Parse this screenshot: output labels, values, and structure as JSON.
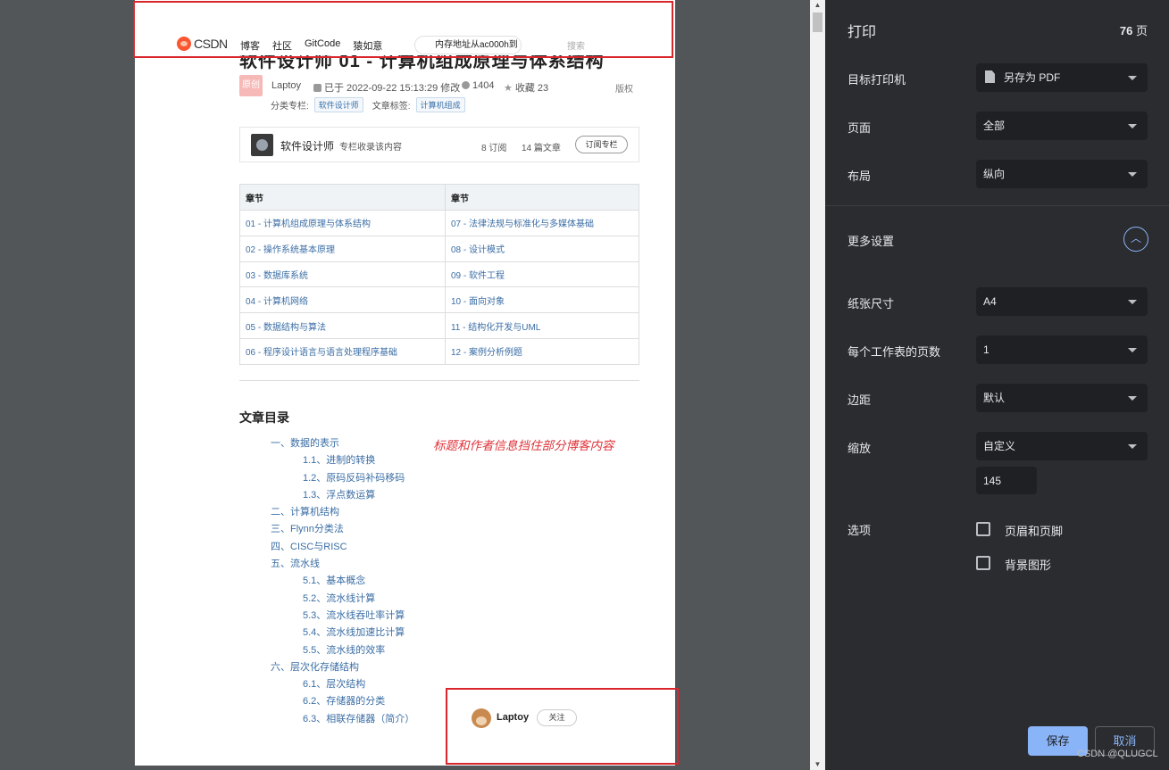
{
  "header": {
    "logo_text": "CSDN",
    "nav": [
      "博客",
      "社区",
      "GitCode",
      "猿如意"
    ],
    "search_value": "内存地址从ac000h到",
    "search_button": "搜索"
  },
  "article": {
    "title_partial": "软件设计师 01 - 计算机组成原理与体系结构",
    "badge": "原创",
    "author": "Laptoy",
    "modified": "已于 2022-09-22 15:13:29 修改",
    "views": "1404",
    "favorites": "收藏 23",
    "copyright": "版权",
    "category_label": "分类专栏:",
    "category_tag": "软件设计师",
    "tag_label": "文章标签:",
    "tag": "计算机组成"
  },
  "column": {
    "name": "软件设计师",
    "sub": "专栏收录该内容",
    "subscribers": "8 订阅",
    "articles": "14 篇文章",
    "subscribe_button": "订阅专栏"
  },
  "chapters": {
    "headers": [
      "章节",
      "章节"
    ],
    "rows": [
      [
        "01 - 计算机组成原理与体系结构",
        "07 - 法律法规与标准化与多媒体基础"
      ],
      [
        "02 - 操作系统基本原理",
        "08 - 设计模式"
      ],
      [
        "03 - 数据库系统",
        "09 - 软件工程"
      ],
      [
        "04 - 计算机网络",
        "10 - 面向对象"
      ],
      [
        "05 - 数据结构与算法",
        "11 - 结构化开发与UML"
      ],
      [
        "06 - 程序设计语言与语言处理程序基础",
        "12 - 案例分析例题"
      ]
    ]
  },
  "toc": {
    "title": "文章目录",
    "items": [
      {
        "level": 1,
        "text": "一、数据的表示"
      },
      {
        "level": 2,
        "text": "1.1、进制的转换"
      },
      {
        "level": 2,
        "text": "1.2、原码反码补码移码"
      },
      {
        "level": 2,
        "text": "1.3、浮点数运算"
      },
      {
        "level": 1,
        "text": "二、计算机结构"
      },
      {
        "level": 1,
        "text": "三、Flynn分类法"
      },
      {
        "level": 1,
        "text": "四、CISC与RISC"
      },
      {
        "level": 1,
        "text": "五、流水线"
      },
      {
        "level": 2,
        "text": "5.1、基本概念"
      },
      {
        "level": 2,
        "text": "5.2、流水线计算"
      },
      {
        "level": 2,
        "text": "5.3、流水线吞吐率计算"
      },
      {
        "level": 2,
        "text": "5.4、流水线加速比计算"
      },
      {
        "level": 2,
        "text": "5.5、流水线的效率"
      },
      {
        "level": 1,
        "text": "六、层次化存储结构"
      },
      {
        "level": 2,
        "text": "6.1、层次结构"
      },
      {
        "level": 2,
        "text": "6.2、存储器的分类"
      },
      {
        "level": 2,
        "text": "6.3、相联存储器（简介）"
      }
    ]
  },
  "annotation": "标题和作者信息挡住部分博客内容",
  "floating_author": {
    "name": "Laptoy",
    "follow": "关注"
  },
  "print_panel": {
    "title": "打印",
    "page_count": "76",
    "page_unit": "页",
    "destination_label": "目标打印机",
    "destination_value": "另存为 PDF",
    "pages_label": "页面",
    "pages_value": "全部",
    "layout_label": "布局",
    "layout_value": "纵向",
    "more_settings": "更多设置",
    "paper_label": "纸张尺寸",
    "paper_value": "A4",
    "per_sheet_label": "每个工作表的页数",
    "per_sheet_value": "1",
    "margins_label": "边距",
    "margins_value": "默认",
    "scale_label": "缩放",
    "scale_value": "自定义",
    "scale_input": "145",
    "options_label": "选项",
    "option_header_footer": "页眉和页脚",
    "option_background": "背景图形",
    "save": "保存",
    "cancel": "取消"
  },
  "watermark": "CSDN @QLUGCL",
  "colors": {
    "accent": "#8ab4f8",
    "panel_bg": "#2b2c2f",
    "annotation_red": "#d9252c",
    "csdn_orange": "#fc5531"
  }
}
